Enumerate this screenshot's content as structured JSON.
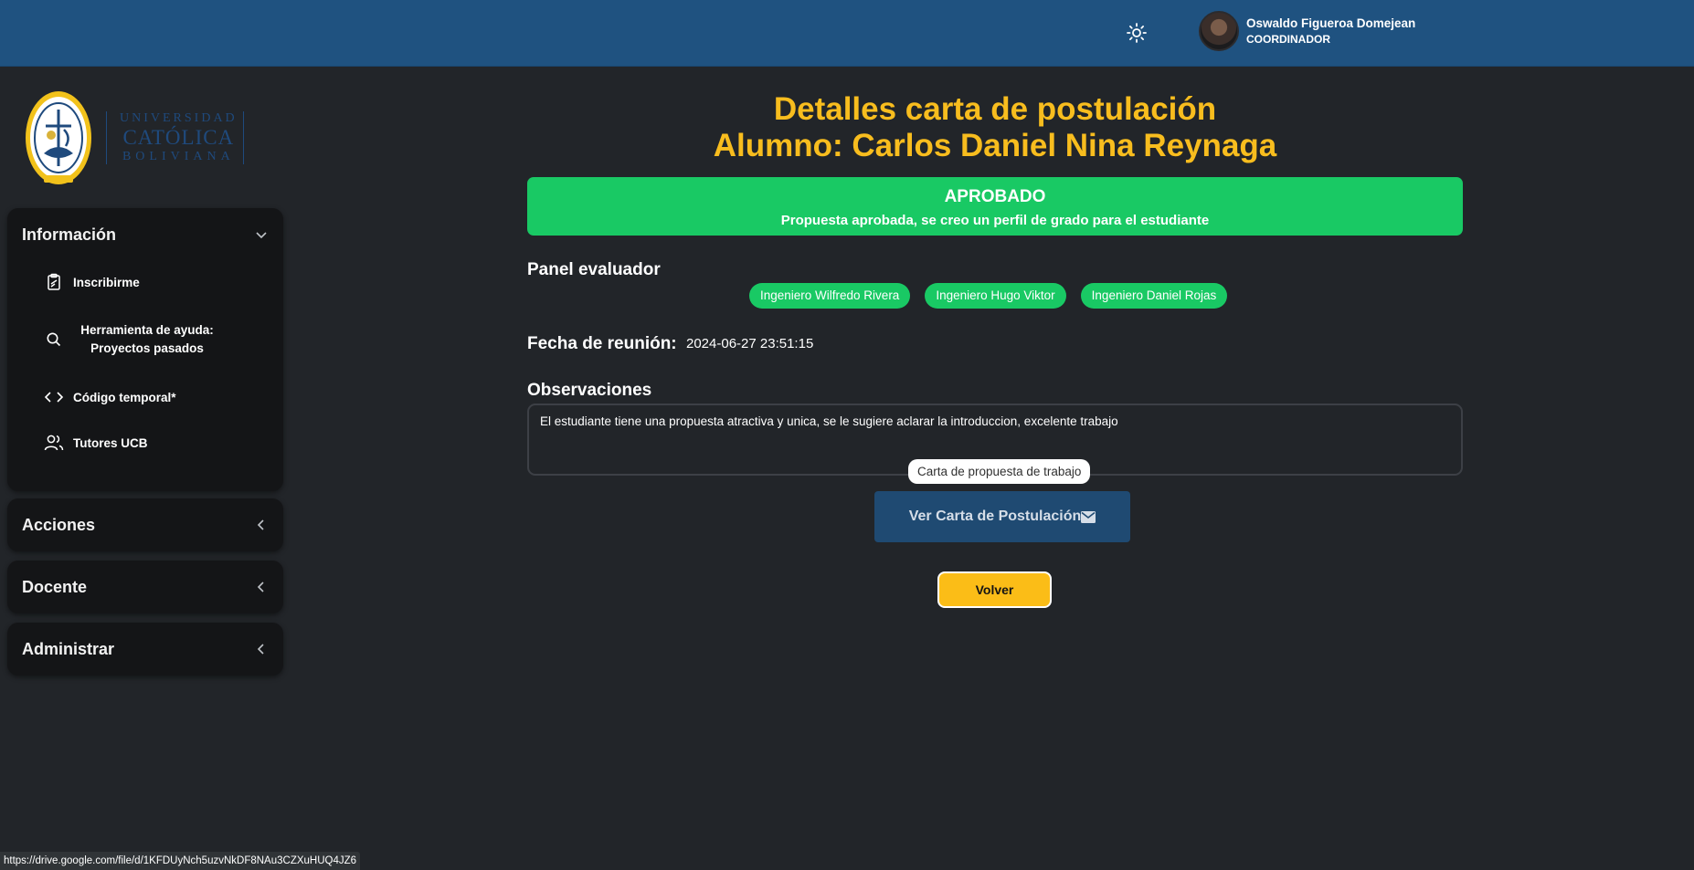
{
  "header": {
    "theme_icon": "sun-icon",
    "user": {
      "name": "Oswaldo Figueroa Domejean",
      "role": "COORDINADOR"
    }
  },
  "sidebar": {
    "logo": {
      "line1": "UNIVERSIDAD",
      "line2": "CATÓLICA",
      "line3": "BOLIVIANA",
      "seal_ring_text": "UNIVERSIDAD CATÓLICA BOLIVIANA SAN PABLO",
      "seal_year": "MCMLXVI"
    },
    "sections": [
      {
        "title": "Información",
        "expanded": true,
        "items": [
          {
            "label": "Inscribirme",
            "icon": "clipboard-icon"
          },
          {
            "label": "Herramienta de ayuda: Proyectos pasados",
            "icon": "search-icon"
          },
          {
            "label": "Código temporal*",
            "icon": "code-icon"
          },
          {
            "label": "Tutores UCB",
            "icon": "users-icon"
          }
        ]
      },
      {
        "title": "Acciones",
        "expanded": false
      },
      {
        "title": "Docente",
        "expanded": false
      },
      {
        "title": "Administrar",
        "expanded": false
      }
    ]
  },
  "main": {
    "title_line1": "Detalles carta de postulación",
    "title_line2": "Alumno: Carlos Daniel Nina Reynaga",
    "status": {
      "title": "APROBADO",
      "description": "Propuesta aprobada, se creo un perfil de grado para el estudiante",
      "color": "#19c964"
    },
    "panel": {
      "label": "Panel evaluador",
      "members": [
        "Ingeniero Wilfredo Rivera",
        "Ingeniero Hugo Viktor",
        "Ingeniero Daniel Rojas"
      ]
    },
    "meeting": {
      "label": "Fecha de reunión:",
      "value": "2024-06-27 23:51:15"
    },
    "observations": {
      "label": "Observaciones",
      "text": "El estudiante tiene una propuesta atractiva y unica, se le sugiere aclarar la introduccion, excelente trabajo"
    },
    "tooltip": "Carta de propuesta de trabajo",
    "view_button": "Ver Carta de Postulación",
    "view_button_icon": "envelope-icon",
    "back_button": "Volver"
  },
  "browser": {
    "status_url": "https://drive.google.com/file/d/1KFDUyNch5uzvNkDF8NAu3CZXuHUQ4JZ6"
  },
  "colors": {
    "header": "#1f5280",
    "background": "#222529",
    "accent": "#f8bd1e",
    "success": "#19c964",
    "button": "#1f4a72"
  }
}
